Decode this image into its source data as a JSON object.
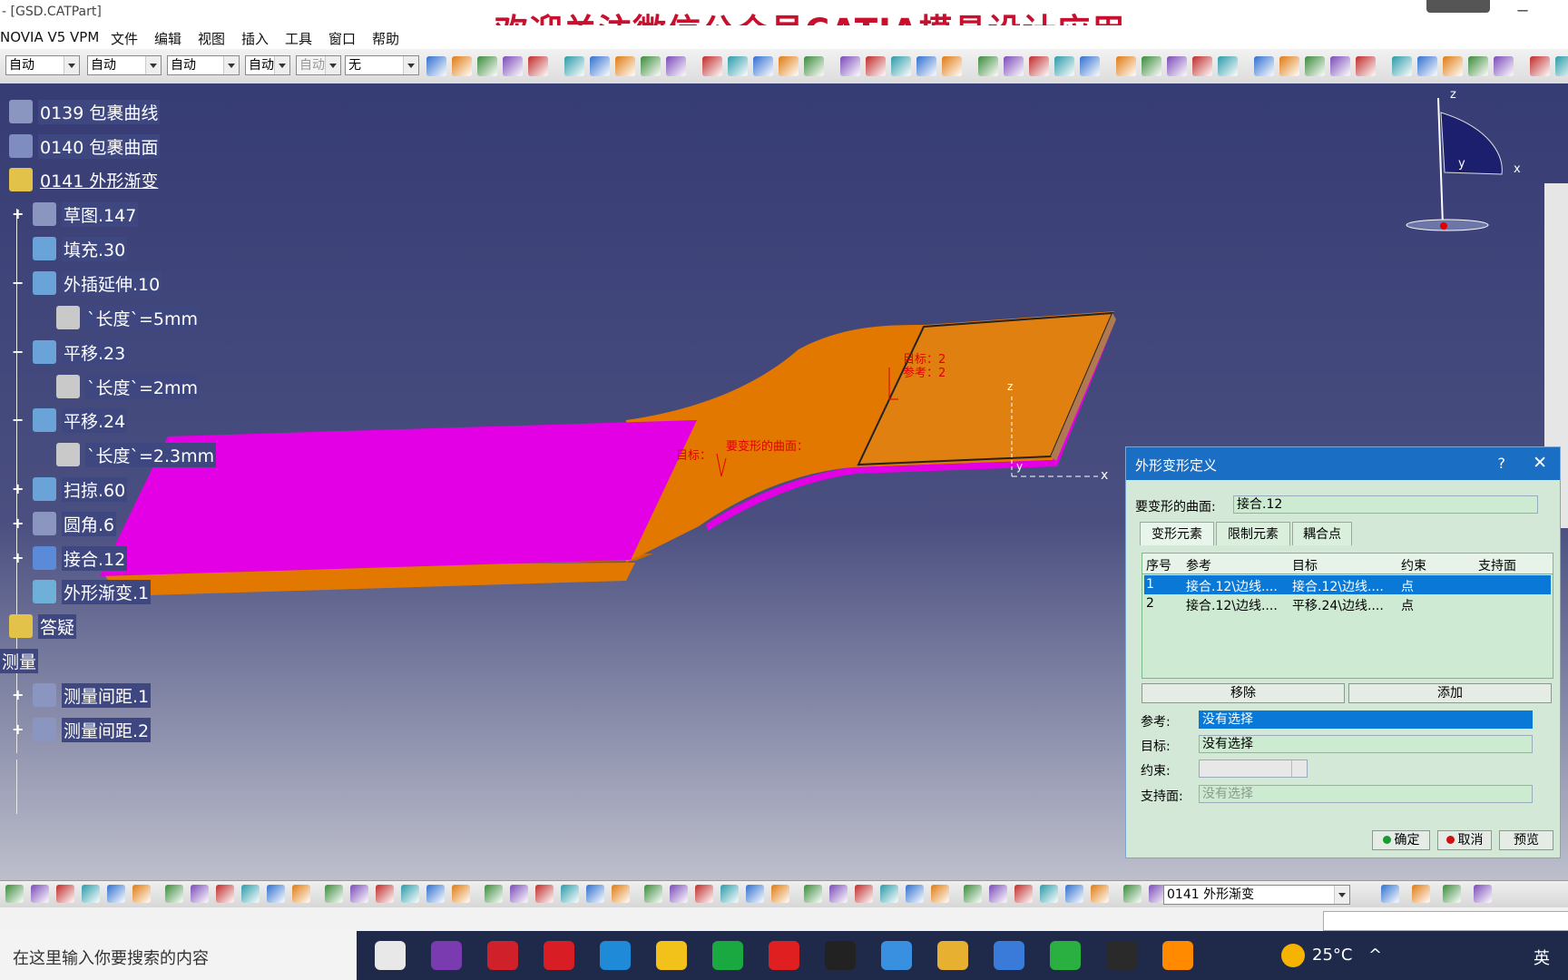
{
  "window": {
    "title": "- [GSD.CATPart]",
    "banner": "欢迎关注微信公众号CATIA模具设计应用",
    "minimize": "─"
  },
  "menu": [
    "NOVIA V5 VPM",
    "文件",
    "编辑",
    "视图",
    "插入",
    "工具",
    "窗口",
    "帮助"
  ],
  "toolbar": {
    "combos": [
      "自动",
      "自动",
      "自动",
      "自动",
      "自动",
      "无"
    ]
  },
  "tree": [
    {
      "label": "0139 包裹曲线",
      "icon": "wrap-curve-icon"
    },
    {
      "label": "0140 包裹曲面",
      "icon": "wrap-surface-icon"
    },
    {
      "label": "0141 外形渐变",
      "icon": "shape-morph-icon"
    },
    {
      "label": "草图.147",
      "icon": "sketch-icon"
    },
    {
      "label": "填充.30",
      "icon": "fill-icon"
    },
    {
      "label": "外插延伸.10",
      "icon": "extrapolate-icon"
    },
    {
      "label": "`长度`=5mm",
      "icon": "parameter-icon"
    },
    {
      "label": "平移.23",
      "icon": "translate-icon"
    },
    {
      "label": "`长度`=2mm",
      "icon": "parameter-icon"
    },
    {
      "label": "平移.24",
      "icon": "translate-icon"
    },
    {
      "label": "`长度`=2.3mm",
      "icon": "parameter-icon"
    },
    {
      "label": "扫掠.60",
      "icon": "sweep-icon"
    },
    {
      "label": "圆角.6",
      "icon": "fillet-icon"
    },
    {
      "label": "接合.12",
      "icon": "join-icon"
    },
    {
      "label": "外形渐变.1",
      "icon": "shape-morphing-icon"
    },
    {
      "label": "答疑",
      "icon": "qa-icon"
    },
    {
      "label": "测量",
      "icon": ""
    },
    {
      "label": "测量间距.1",
      "icon": "measure-icon"
    },
    {
      "label": "测量间距.2",
      "icon": "measure-icon"
    }
  ],
  "annotations": {
    "target": "目标：2",
    "reference": "参考：2",
    "deform_surface": "要变形的曲面：",
    "target_short": "目标："
  },
  "axes": {
    "z": "z",
    "x": "x",
    "y": "y"
  },
  "dialog": {
    "title": "外形变形定义",
    "help": "?",
    "close": "✕",
    "surface_label": "要变形的曲面:",
    "surface_value": "接合.12",
    "tabs": [
      "变形元素",
      "限制元素",
      "耦合点"
    ],
    "columns": [
      "序号",
      "参考",
      "目标",
      "约束",
      "支持面"
    ],
    "rows": [
      {
        "no": "1",
        "ref": "接合.12\\边线....",
        "target": "接合.12\\边线....",
        "constraint": "点",
        "support": ""
      },
      {
        "no": "2",
        "ref": "接合.12\\边线....",
        "target": "平移.24\\边线....",
        "constraint": "点",
        "support": ""
      }
    ],
    "remove": "移除",
    "add": "添加",
    "ref_label": "参考:",
    "ref_value": "没有选择",
    "target_label": "目标:",
    "target_value": "没有选择",
    "constraint_label": "约束:",
    "support_label": "支持面:",
    "support_value": "没有选择",
    "ok": "确定",
    "cancel": "取消",
    "preview": "预览"
  },
  "bottom_toolbar": {
    "combo": "0141 外形渐变"
  },
  "taskbar": {
    "search": "在这里输入你要搜索的内容",
    "temperature": "25°C",
    "ime": "英"
  },
  "colors": {
    "magenta": "#e400e4",
    "orange": "#e27800",
    "dialog_bg": "#d3e8d6",
    "title_blue": "#1a6fc4"
  }
}
